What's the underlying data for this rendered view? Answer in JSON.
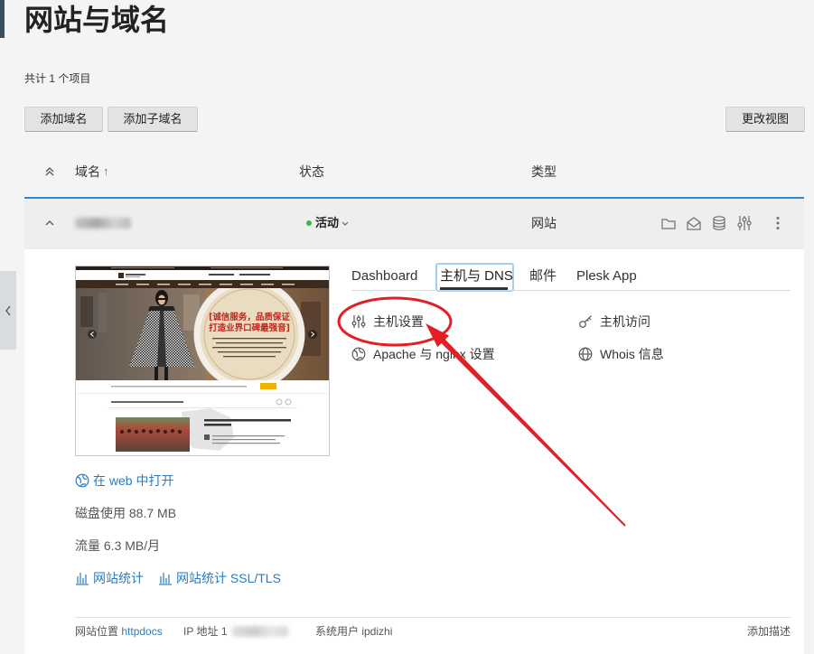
{
  "sidebar": {
    "toggle_icon": "chevron-left-icon"
  },
  "page": {
    "title": "网站与域名",
    "item_count": "共计 1 个项目"
  },
  "toolbar": {
    "add_domain": "添加域名",
    "add_subdomain": "添加子域名",
    "change_view": "更改视图"
  },
  "columns": {
    "domain": "域名",
    "sort_indicator": "↑",
    "status": "状态",
    "type": "类型"
  },
  "row": {
    "status": "活动",
    "type": "网站",
    "actions": [
      "folder-icon",
      "open-envelope-icon",
      "database-icon",
      "sliders-icon",
      "kebab-menu-icon"
    ]
  },
  "details": {
    "tabs": [
      {
        "label": "Dashboard",
        "active": false
      },
      {
        "label": "主机与 DNS",
        "active": true
      },
      {
        "label": "邮件",
        "active": false
      },
      {
        "label": "Plesk App",
        "active": false
      }
    ],
    "links": [
      {
        "label": "主机设置",
        "icon": "sliders-icon"
      },
      {
        "label": "主机访问",
        "icon": "key-icon"
      },
      {
        "label": "Apache 与 nginx 设置",
        "icon": "apache-globe-icon"
      },
      {
        "label": "Whois 信息",
        "icon": "globe-icon"
      }
    ],
    "open_in_web": "在 web 中打开",
    "disk_usage": "磁盘使用 88.7 MB",
    "traffic": "流量 6.3 MB/月",
    "stats": "网站统计",
    "stats_ssl": "网站统计 SSL/TLS",
    "footer": {
      "site_location_label": "网站位置",
      "site_location_value": "httpdocs",
      "ip_label": "IP 地址",
      "ip_value_visible": "1",
      "system_user": "系统用户 ipdizhi",
      "add_description": "添加描述"
    }
  },
  "thumbnail": {
    "badge_line1": "[诚信服务，品质保证",
    "badge_line2": "打造业界口碑最强音]"
  },
  "colors": {
    "accent": "#2e89d2",
    "link": "#2b7bbd",
    "status_active": "#3bb54a",
    "annotation": "#e31e24"
  }
}
